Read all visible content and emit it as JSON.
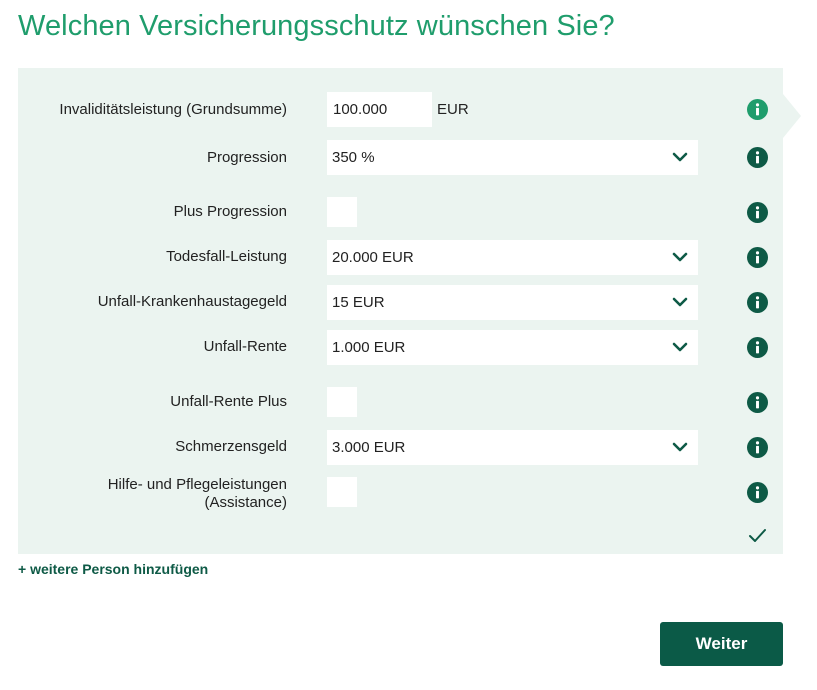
{
  "page_title": "Welchen Versicherungsschutz wünschen Sie?",
  "rows": [
    {
      "label": "Invaliditätsleistung (Grundsumme)",
      "value": "100.000",
      "unit": "EUR"
    },
    {
      "label": "Progression",
      "value": "350 %"
    },
    {
      "label": "Plus Progression"
    },
    {
      "label": "Todesfall-Leistung",
      "value": "20.000 EUR"
    },
    {
      "label": "Unfall-Krankenhaustagegeld",
      "value": "15 EUR"
    },
    {
      "label": "Unfall-Rente",
      "value": "1.000 EUR"
    },
    {
      "label": "Unfall-Rente Plus"
    },
    {
      "label": "Schmerzensgeld",
      "value": "3.000 EUR"
    },
    {
      "label_line1": "Hilfe- und Pflegeleistungen",
      "label_line2": "(Assistance)"
    }
  ],
  "add_person_label": "+ weitere Person hinzufügen",
  "weiter_label": "Weiter",
  "colors": {
    "title": "#1f9d6c",
    "panel_bg": "#ebf4f0",
    "active_info": "#1f9d6c",
    "info": "#0e5a46",
    "button_bg": "#0b5a47"
  },
  "icons": {
    "info": "info-icon",
    "select": "chevron-down-icon",
    "done": "checkmark-icon"
  }
}
